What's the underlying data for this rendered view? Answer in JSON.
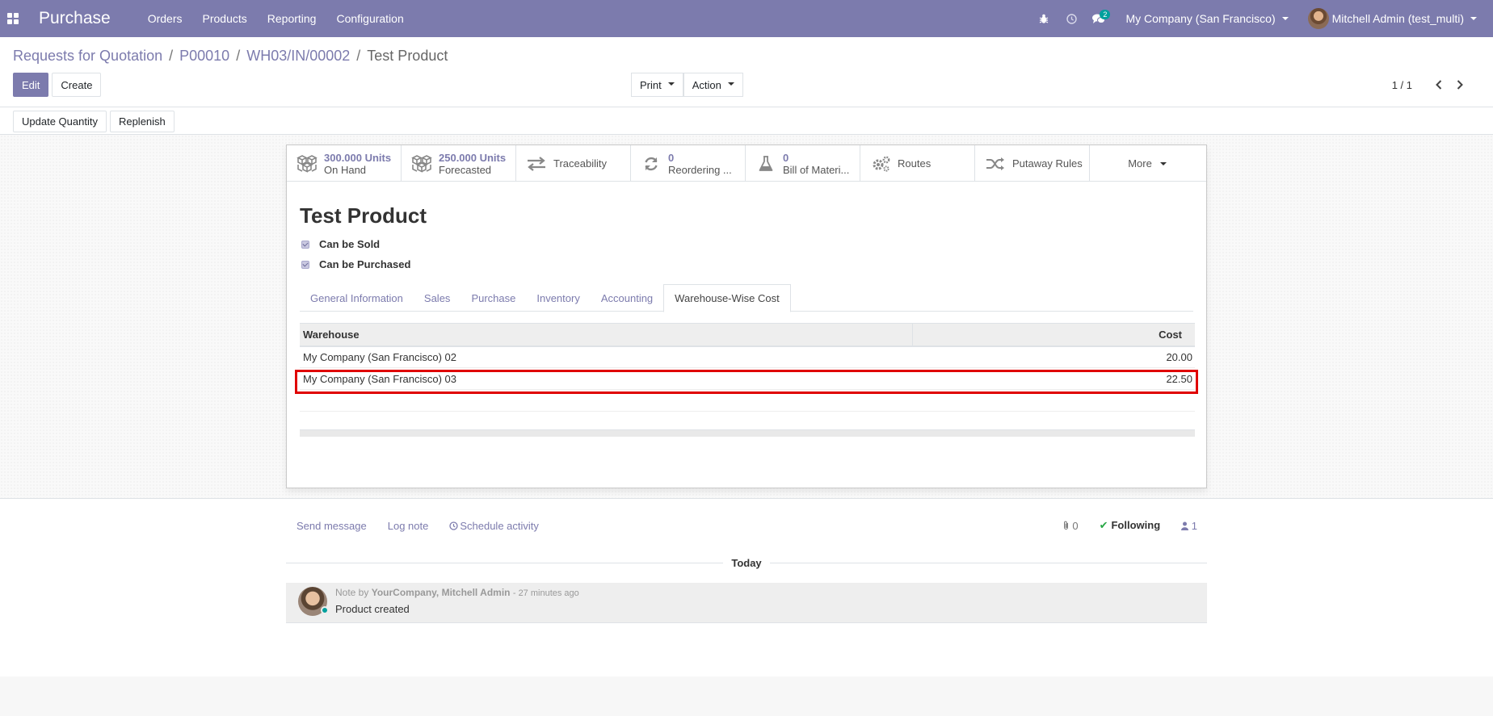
{
  "navbar": {
    "app_name": "Purchase",
    "menu": [
      "Orders",
      "Products",
      "Reporting",
      "Configuration"
    ],
    "messages_count": "2",
    "company": "My Company (San Francisco)",
    "user": "Mitchell Admin (test_multi)"
  },
  "breadcrumb": [
    "Requests for Quotation",
    "P00010",
    "WH03/IN/00002"
  ],
  "breadcrumb_active": "Test Product",
  "actions": {
    "edit": "Edit",
    "create": "Create",
    "print": "Print",
    "action": "Action"
  },
  "pager": {
    "value": "1 / 1"
  },
  "statusbar": {
    "update_quantity": "Update Quantity",
    "replenish": "Replenish"
  },
  "smart_buttons": {
    "on_hand_value": "300.000 Units",
    "on_hand_label": "On Hand",
    "forecasted_value": "250.000 Units",
    "forecasted_label": "Forecasted",
    "traceability": "Traceability",
    "reordering_value": "0",
    "reordering_label": "Reordering ...",
    "bom_value": "0",
    "bom_label": "Bill of Materi...",
    "routes": "Routes",
    "putaway": "Putaway Rules",
    "more": "More"
  },
  "product": {
    "name": "Test Product",
    "can_be_sold": "Can be Sold",
    "can_be_purchased": "Can be Purchased"
  },
  "tabs": [
    "General Information",
    "Sales",
    "Purchase",
    "Inventory",
    "Accounting",
    "Warehouse-Wise Cost"
  ],
  "table": {
    "headers": [
      "Warehouse",
      "Cost"
    ],
    "rows": [
      [
        "My Company (San Francisco) 02",
        "20.00"
      ],
      [
        "My Company (San Francisco) 03",
        "22.50"
      ]
    ]
  },
  "chatter": {
    "send_message": "Send message",
    "log_note": "Log note",
    "schedule_activity": "Schedule activity",
    "attachments": "0",
    "following": "Following",
    "followers": "1",
    "today": "Today",
    "note_prefix": "Note by",
    "author": "YourCompany, Mitchell Admin",
    "time": "- 27 minutes ago",
    "body": "Product created"
  },
  "colors": {
    "brand": "#7c7bad",
    "highlight": "#e00000",
    "online": "#00a09d"
  }
}
